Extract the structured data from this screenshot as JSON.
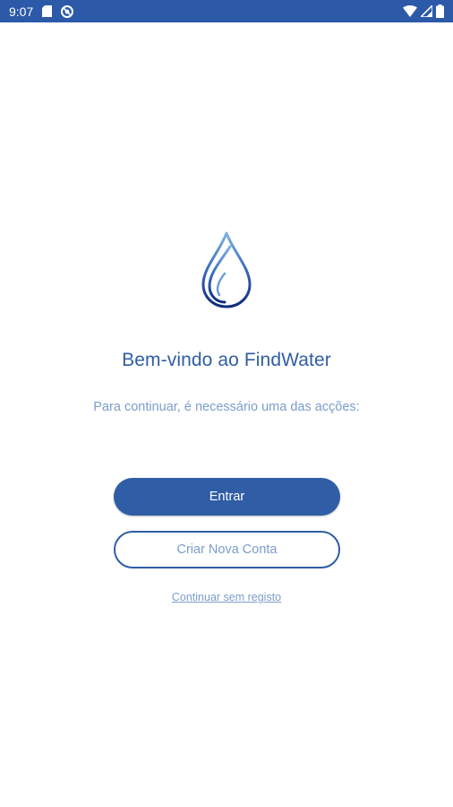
{
  "status_bar": {
    "time": "9:07",
    "background_color": "#2c5aa8",
    "icons_left": [
      "sd-card-icon",
      "blocked-app-icon"
    ],
    "icons_right": [
      "wifi-icon",
      "cell-signal-icon",
      "battery-icon"
    ]
  },
  "main": {
    "logo_icon": "water-drop-icon",
    "welcome_title": "Bem-vindo ao FindWater",
    "subtitle": "Para continuar, é necessário uma das acções:",
    "login_button_label": "Entrar",
    "create_account_button_label": "Criar Nova Conta",
    "continue_without_registration_link": "Continuar sem registo"
  },
  "colors": {
    "primary": "#2f5da6",
    "secondary_text": "#7b9dcc",
    "background": "#ffffff"
  }
}
